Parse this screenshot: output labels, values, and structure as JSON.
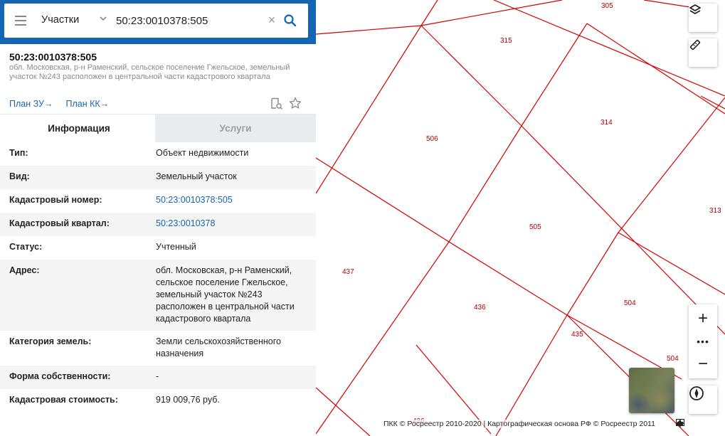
{
  "search": {
    "category": "Участки",
    "query": "50:23:0010378:505"
  },
  "object": {
    "cadastral_number": "50:23:0010378:505",
    "address_short": "обл. Московская, р-н Раменский, сельское поселение Гжельское, земельный участок №243 расположен в центральной части кадастрового квартала"
  },
  "links": {
    "plan_zu": "План ЗУ",
    "plan_kk": "План КК"
  },
  "tabs": {
    "info": "Информация",
    "services": "Услуги"
  },
  "rows": [
    {
      "key": "Тип:",
      "value": "Объект недвижимости"
    },
    {
      "key": "Вид:",
      "value": "Земельный участок"
    },
    {
      "key": "Кадастровый номер:",
      "value": "50:23:0010378:505"
    },
    {
      "key": "Кадастровый квартал:",
      "value": "50:23:0010378"
    },
    {
      "key": "Статус:",
      "value": "Учтенный"
    },
    {
      "key": "Адрес:",
      "value": "обл. Московская, р-н Раменский, сельское поселение Гжельское, земельный участок №243 расположен в центральной части кадастрового квартала"
    },
    {
      "key": "Категория земель:",
      "value": "Земли сельскохозяйственного назначения"
    },
    {
      "key": "Форма собственности:",
      "value": "-"
    },
    {
      "key": "Кадастровая стоимость:",
      "value": "919 009,76 руб."
    }
  ],
  "map": {
    "plot_labels": [
      "305",
      "315",
      "506",
      "314",
      "313",
      "505",
      "437",
      "436",
      "504",
      "435",
      "504",
      "436"
    ],
    "attribution": "ПКК © Росреестр 2010-2020 | Картографическая основа РФ © Росреестр 2011",
    "zoom_more": "•••",
    "zoom_in": "+",
    "zoom_out": "−"
  },
  "colors": {
    "brand_blue": "#1565b5",
    "boundary_red": "#d40000",
    "label_red": "#b00000"
  }
}
